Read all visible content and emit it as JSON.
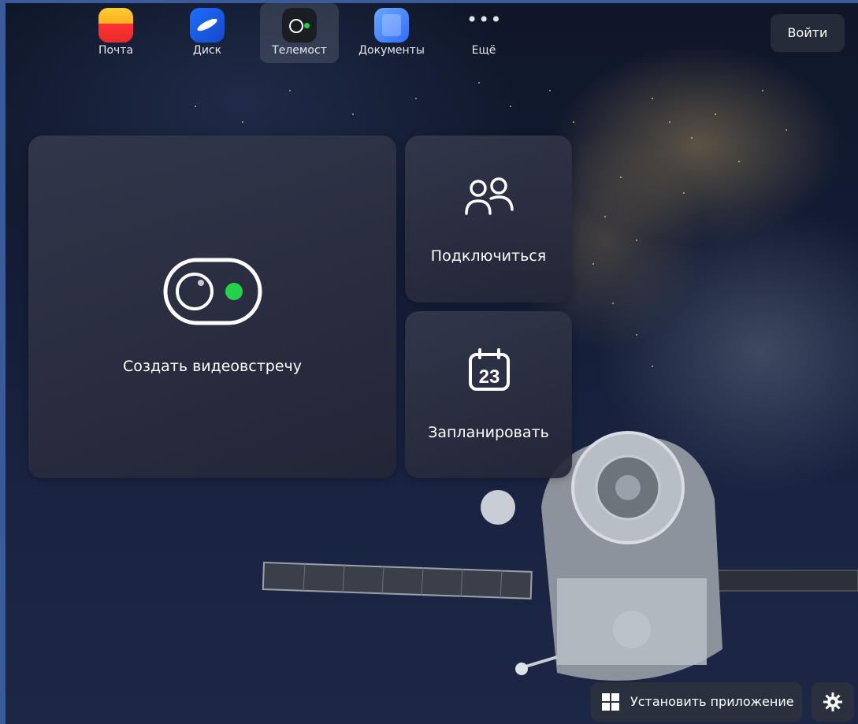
{
  "apps": [
    {
      "label": "Почта",
      "icon": "mail-icon",
      "active": false
    },
    {
      "label": "Диск",
      "icon": "disk-icon",
      "active": false
    },
    {
      "label": "Телемост",
      "icon": "telemost-icon",
      "active": true
    },
    {
      "label": "Документы",
      "icon": "documents-icon",
      "active": false
    },
    {
      "label": "Ещё",
      "icon": "more-icon",
      "active": false
    }
  ],
  "header": {
    "login_label": "Войти"
  },
  "cards": {
    "create": {
      "label": "Создать видеовстречу",
      "icon": "video-toggle-icon"
    },
    "join": {
      "label": "Подключиться",
      "icon": "people-icon"
    },
    "schedule": {
      "label": "Запланировать",
      "icon": "calendar-icon",
      "calendar_day": "23"
    }
  },
  "footer": {
    "install_label": "Установить приложение",
    "install_icon": "windows-icon",
    "settings_icon": "gear-icon"
  },
  "colors": {
    "accent_green": "#22d34a",
    "card_bg": "#2a2d3f"
  }
}
